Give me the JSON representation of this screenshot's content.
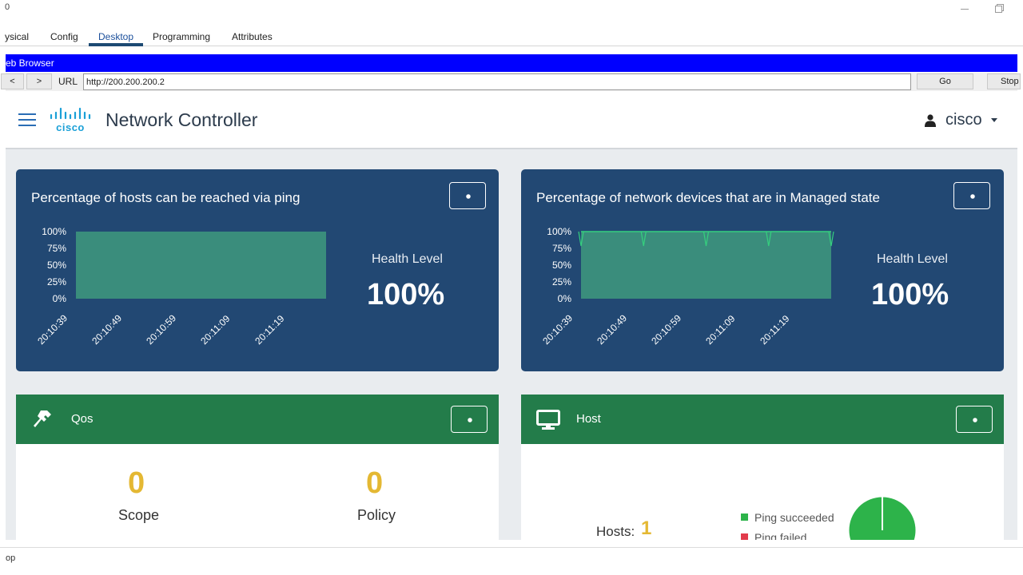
{
  "window": {
    "title": "0"
  },
  "tabs": [
    {
      "label": "ysical"
    },
    {
      "label": "Config"
    },
    {
      "label": "Desktop"
    },
    {
      "label": "Programming"
    },
    {
      "label": "Attributes"
    }
  ],
  "browser": {
    "title": "eb Browser",
    "back_label": "<",
    "forward_label": ">",
    "url_label": "URL",
    "url": "http://200.200.200.2",
    "go_label": "Go",
    "stop_label": "Stop"
  },
  "app": {
    "title": "Network Controller",
    "user": "cisco"
  },
  "cards": {
    "hosts_ping": {
      "title": "Percentage of hosts can be reached via ping",
      "health_label": "Health Level",
      "health_value": "100%"
    },
    "devices_managed": {
      "title": "Percentage of network devices that are in Managed state",
      "health_label": "Health Level",
      "health_value": "100%"
    },
    "qos": {
      "title": "Qos",
      "scope_value": "0",
      "scope_label": "Scope",
      "policy_value": "0",
      "policy_label": "Policy"
    },
    "host": {
      "title": "Host",
      "hosts_label": "Hosts:",
      "hosts_value": "1",
      "legend_ping_succeeded": "Ping succeeded",
      "legend_ping_failed": "Ping failed",
      "ping_succeeded_color": "#2db34a",
      "ping_failed_color": "#e23b4b"
    }
  },
  "chart_data": [
    {
      "type": "area",
      "title": "Percentage of hosts can be reached via ping",
      "x": [
        "20:10:39",
        "20:10:49",
        "20:10:59",
        "20:11:09",
        "20:11:19"
      ],
      "series": [
        {
          "values": [
            100,
            100,
            100,
            100,
            100
          ]
        }
      ],
      "y_ticks": [
        "100%",
        "75%",
        "50%",
        "25%",
        "0%"
      ],
      "ylim": [
        0,
        100
      ],
      "fill_color": "#3a8d7c"
    },
    {
      "type": "area",
      "title": "Percentage of network devices that are in Managed state",
      "x": [
        "20:10:39",
        "20:10:49",
        "20:10:59",
        "20:11:09",
        "20:11:19"
      ],
      "series": [
        {
          "values": [
            100,
            100,
            100,
            100,
            100
          ]
        }
      ],
      "y_ticks": [
        "100%",
        "75%",
        "50%",
        "25%",
        "0%"
      ],
      "ylim": [
        0,
        100
      ],
      "fill_color": "#3a8d7c",
      "line_color": "#35d07e"
    },
    {
      "type": "pie",
      "categories": [
        "Ping succeeded",
        "Ping failed"
      ],
      "values": [
        1,
        0
      ],
      "colors": [
        "#2db34a",
        "#e23b4b"
      ]
    }
  ],
  "status": {
    "text": "op"
  }
}
